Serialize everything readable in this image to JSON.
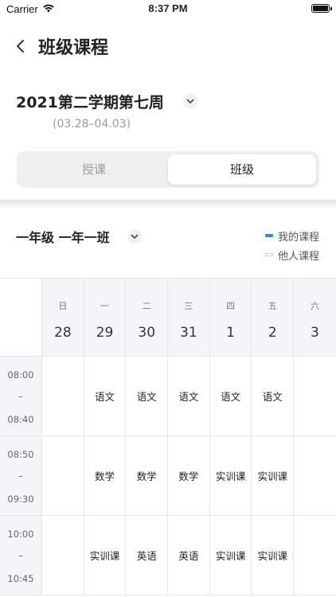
{
  "status_bar": {
    "carrier": "Carrier",
    "time": "8:37 PM"
  },
  "header": {
    "title": "班级课程"
  },
  "week": {
    "title": "2021第二学期第七周",
    "range": "(03.28–04.03)"
  },
  "segment": {
    "left_label": "授课",
    "right_label": "班级",
    "selected": "班级"
  },
  "class_selector": {
    "label": "一年级 一年一班"
  },
  "legend": {
    "mine": "我的课程",
    "others": "他人课程",
    "mine_color": "#3b82e8"
  },
  "days": [
    {
      "dow": "日",
      "date": "28"
    },
    {
      "dow": "一",
      "date": "29"
    },
    {
      "dow": "二",
      "date": "30"
    },
    {
      "dow": "三",
      "date": "31"
    },
    {
      "dow": "四",
      "date": "1"
    },
    {
      "dow": "五",
      "date": "2"
    },
    {
      "dow": "六",
      "date": "3"
    }
  ],
  "periods": [
    {
      "start": "08:00",
      "sep": "–",
      "end": "08:40",
      "cells": [
        "",
        "语文",
        "语文",
        "语文",
        "语文",
        "语文",
        ""
      ]
    },
    {
      "start": "08:50",
      "sep": "–",
      "end": "09:30",
      "cells": [
        "",
        "数学",
        "数学",
        "数学",
        "实训课",
        "实训课",
        ""
      ]
    },
    {
      "start": "10:00",
      "sep": "–",
      "end": "10:45",
      "cells": [
        "",
        "实训课",
        "英语",
        "英语",
        "实训课",
        "实训课",
        ""
      ]
    }
  ]
}
